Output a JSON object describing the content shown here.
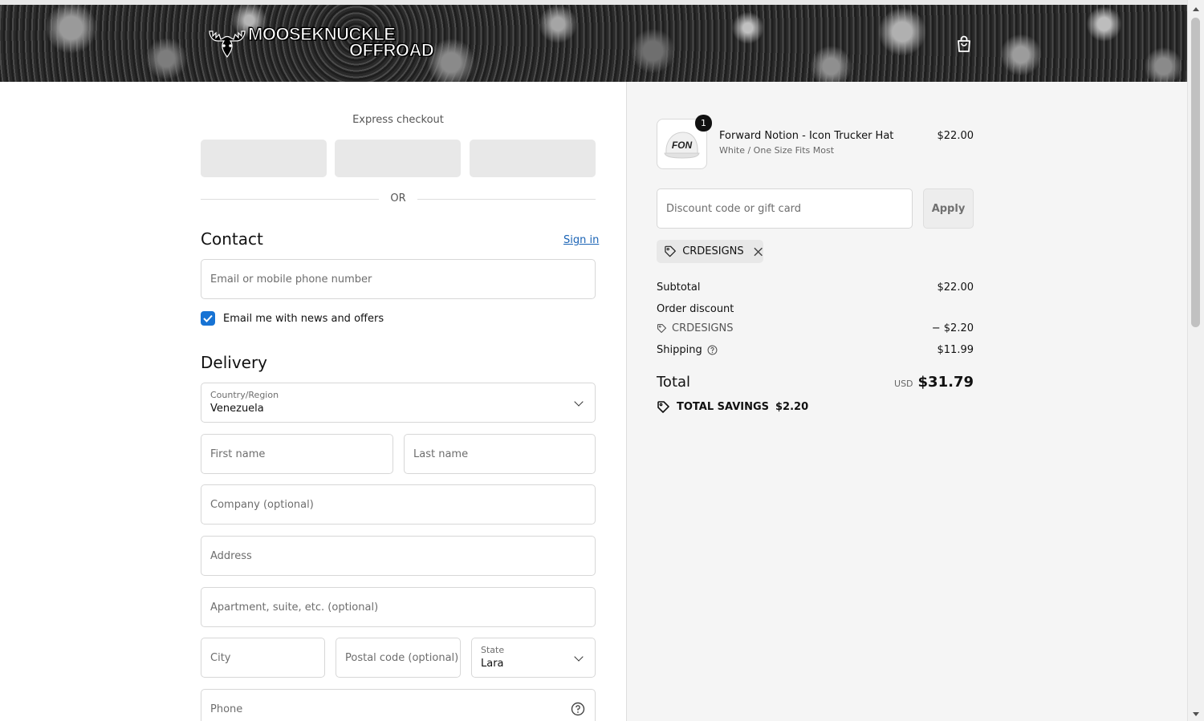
{
  "brand": {
    "logo_line1": "MOOSEKNUCKLE",
    "logo_line2": "OFFROAD"
  },
  "express": {
    "title": "Express checkout",
    "separator": "OR"
  },
  "contact": {
    "heading": "Contact",
    "sign_in": "Sign in",
    "email_placeholder": "Email or mobile phone number",
    "newsletter_label": "Email me with news and offers",
    "newsletter_checked": true
  },
  "delivery": {
    "heading": "Delivery",
    "country_label": "Country/Region",
    "country_value": "Venezuela",
    "first_name_placeholder": "First name",
    "last_name_placeholder": "Last name",
    "company_placeholder": "Company (optional)",
    "address_placeholder": "Address",
    "apartment_placeholder": "Apartment, suite, etc. (optional)",
    "city_placeholder": "City",
    "postal_placeholder": "Postal code (optional)",
    "state_label": "State",
    "state_value": "Lara",
    "phone_placeholder": "Phone"
  },
  "summary": {
    "product": {
      "quantity": "1",
      "name": "Forward Notion - Icon Trucker Hat",
      "variant": "White / One Size Fits Most",
      "price": "$22.00",
      "image_text": "FON"
    },
    "discount_placeholder": "Discount code or gift card",
    "apply_label": "Apply",
    "applied_code": "CRDESIGNS",
    "subtotal_label": "Subtotal",
    "subtotal_value": "$22.00",
    "order_discount_label": "Order discount",
    "order_discount_code": "CRDESIGNS",
    "order_discount_value": "− $2.20",
    "shipping_label": "Shipping",
    "shipping_value": "$11.99",
    "total_label": "Total",
    "currency": "USD",
    "total_value": "$31.79",
    "savings_label": "TOTAL SAVINGS",
    "savings_value": "$2.20"
  },
  "colors": {
    "accent": "#1773d4",
    "link": "#1a63b5",
    "summary_bg": "#f5f5f5"
  }
}
